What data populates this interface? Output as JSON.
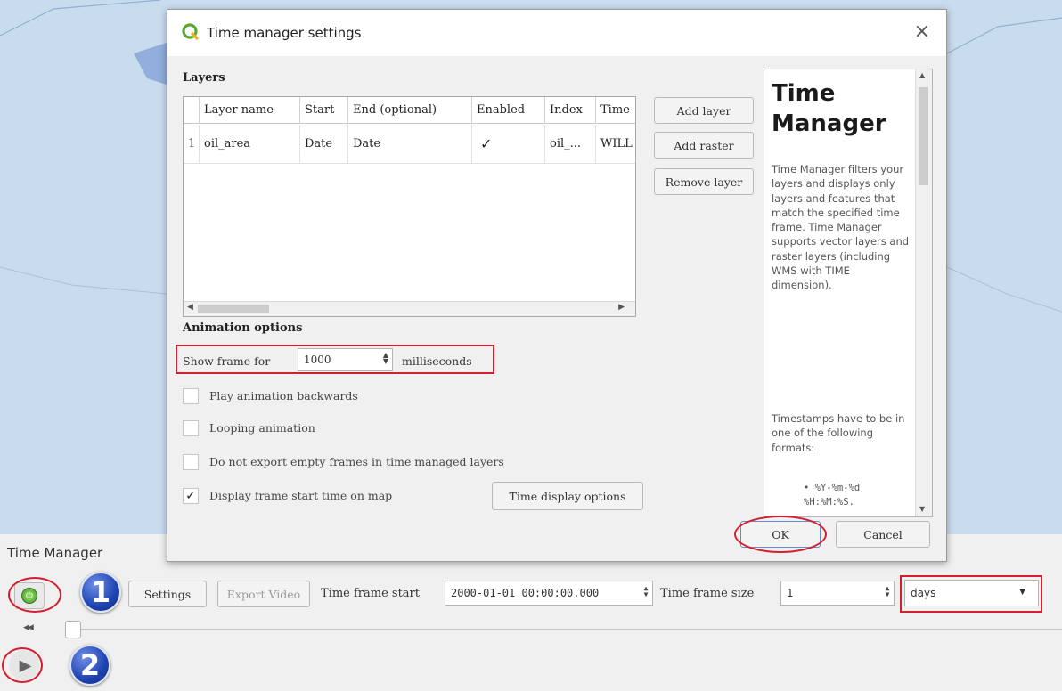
{
  "dialog": {
    "title": "Time manager settings",
    "close": "×",
    "layers_section": "Layers",
    "columns": [
      "Layer name",
      "Start",
      "End (optional)",
      "Enabled",
      "Index",
      "Time"
    ],
    "rows": [
      {
        "num": "1",
        "layer_name": "oil_area",
        "start": "Date",
        "end": "Date",
        "enabled": "✓",
        "index": "oil_...",
        "time": "WILL"
      }
    ],
    "add_layer": "Add layer",
    "add_raster": "Add raster",
    "remove_layer": "Remove layer",
    "animation_section": "Animation options",
    "show_frame_for": "Show frame for",
    "frame_ms": "1000",
    "milliseconds": "milliseconds",
    "options": [
      {
        "label": "Play animation backwards",
        "checked": ""
      },
      {
        "label": "Looping animation",
        "checked": ""
      },
      {
        "label": "Do not export empty frames in time managed layers",
        "checked": ""
      },
      {
        "label": "Display frame start time on map",
        "checked": "✓"
      }
    ],
    "time_display_options": "Time display options",
    "ok": "OK",
    "cancel": "Cancel"
  },
  "help": {
    "heading": "Time Manager",
    "paragraph1": "Time Manager filters your layers and displays only layers and features that match the specified time frame. Time Manager supports vector layers and raster layers (including WMS with TIME dimension).",
    "paragraph2": "Timestamps have to be in one of the following formats:",
    "bullet1": "• %Y-%m-%d %H:%M:%S."
  },
  "panel": {
    "title": "Time Manager",
    "settings": "Settings",
    "export_video": "Export Video",
    "time_frame_start_label": "Time frame start",
    "time_frame_start": "2000-01-01 00:00:00.000",
    "time_frame_size_label": "Time frame size",
    "time_frame_size": "1",
    "unit": "days",
    "rewind": "◀◀",
    "badge1": "1",
    "badge2": "2"
  },
  "colors": {
    "annotation_red": "#d32030",
    "badge_blue": "#1f43b0",
    "map_water": "#c9dcee"
  }
}
